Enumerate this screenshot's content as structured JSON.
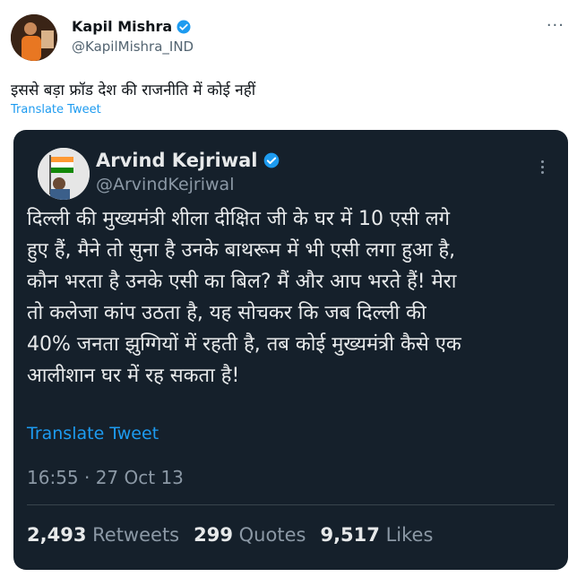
{
  "outer": {
    "name": "Kapil Mishra",
    "handle": "@KapilMishra_IND",
    "text": "इससे बड़ा फ्रॉड देश की राजनीति में कोई नहीं",
    "translate": "Translate Tweet",
    "more_icon": "more-dots-icon"
  },
  "quoted": {
    "name": "Arvind Kejriwal",
    "handle": "@ArvindKejriwal",
    "text": "दिल्ली की मुख्यमंत्री शीला दीक्षित जी के घर में 10 एसी लगे\nहुए हैं, मैने तो सुना है उनके बाथरूम में भी एसी लगा हुआ है,\nकौन भरता है उनके एसी का बिल? मैं और आप भरते हैं! मेरा\nतो कलेजा कांप उठता है, यह सोचकर कि जब दिल्ली की\n40% जनता झुग्गियों में रहती है, तब कोई मुख्यमंत्री कैसे एक\nआलीशान घर में रह सकता है!",
    "translate": "Translate Tweet",
    "timestamp": "16:55 · 27 Oct 13",
    "stats": {
      "retweets_count": "2,493",
      "retweets_label": "Retweets",
      "quotes_count": "299",
      "quotes_label": "Quotes",
      "likes_count": "9,517",
      "likes_label": "Likes"
    }
  },
  "colors": {
    "accent": "#1d9bf0",
    "card_bg": "#15202b"
  }
}
